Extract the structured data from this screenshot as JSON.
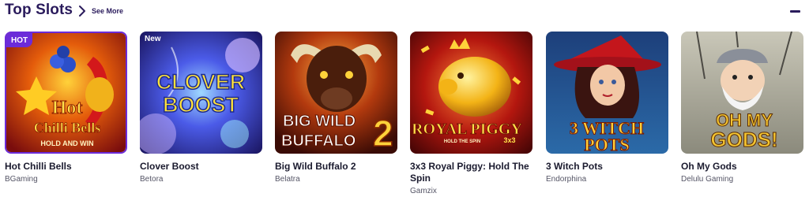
{
  "header": {
    "title": "Top Slots",
    "see_more": "See More"
  },
  "games": [
    {
      "name": "Hot Chilli Bells",
      "provider": "BGaming",
      "badge": "HOT",
      "art_line1": "Hot",
      "art_line2": "Chilli Bells",
      "art_line3": "HOLD AND WIN"
    },
    {
      "name": "Clover Boost",
      "provider": "Betora",
      "badge": "New",
      "art_line1": "CLOVER",
      "art_line2": "BOOST"
    },
    {
      "name": "Big Wild Buffalo 2",
      "provider": "Belatra",
      "art_line1": "BIG WILD",
      "art_line2": "BUFFALO",
      "art_num": "2"
    },
    {
      "name": "3x3 Royal Piggy: Hold The Spin",
      "provider": "Gamzix",
      "art_line1": "ROYAL PIGGY",
      "art_line2": "HOLD THE SPIN",
      "art_num": "3x3"
    },
    {
      "name": "3 Witch Pots",
      "provider": "Endorphina",
      "art_line1": "3 WITCH",
      "art_line2": "POTS"
    },
    {
      "name": "Oh My Gods",
      "provider": "Delulu Gaming",
      "art_line1": "OH MY",
      "art_line2": "GODS!"
    }
  ],
  "colors": {
    "accent": "#6b2bd9",
    "heading": "#2a1b5c"
  }
}
